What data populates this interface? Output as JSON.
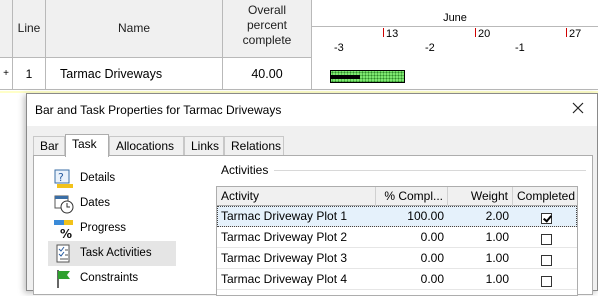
{
  "gantt": {
    "headers": {
      "line": "Line",
      "name": "Name",
      "overall_line1": "Overall",
      "overall_line2": "percent",
      "overall_line3": "complete"
    },
    "timescale": {
      "month": "June",
      "week_labels": [
        "13",
        "20",
        "27"
      ],
      "day_labels": [
        "-3",
        "-2",
        "-1"
      ]
    },
    "row": {
      "marker": "+",
      "line": "1",
      "name": "Tarmac Driveways",
      "overall_percent": "40.00"
    },
    "bar_colors": {
      "remaining": "#7de870",
      "done": "#000000"
    }
  },
  "dialog": {
    "title": "Bar and Task Properties for Tarmac Driveways",
    "tabs": [
      "Bar",
      "Task",
      "Allocations",
      "Links",
      "Relations"
    ],
    "active_tab": "Task",
    "nav_items": [
      {
        "label": "Details",
        "icon": "details-icon"
      },
      {
        "label": "Dates",
        "icon": "dates-icon"
      },
      {
        "label": "Progress",
        "icon": "progress-icon"
      },
      {
        "label": "Task Activities",
        "icon": "task-activities-icon"
      },
      {
        "label": "Constraints",
        "icon": "constraints-icon"
      }
    ],
    "selected_nav": "Task Activities",
    "activities": {
      "group_label": "Activities",
      "columns": [
        "Activity",
        "% Compl...",
        "Weight",
        "Completed"
      ],
      "rows": [
        {
          "activity": "Tarmac Driveway Plot 1",
          "pct": "100.00",
          "weight": "2.00",
          "completed": true
        },
        {
          "activity": "Tarmac Driveway Plot 2",
          "pct": "0.00",
          "weight": "1.00",
          "completed": false
        },
        {
          "activity": "Tarmac Driveway Plot 3",
          "pct": "0.00",
          "weight": "1.00",
          "completed": false
        },
        {
          "activity": "Tarmac Driveway Plot 4",
          "pct": "0.00",
          "weight": "1.00",
          "completed": false
        }
      ]
    }
  }
}
